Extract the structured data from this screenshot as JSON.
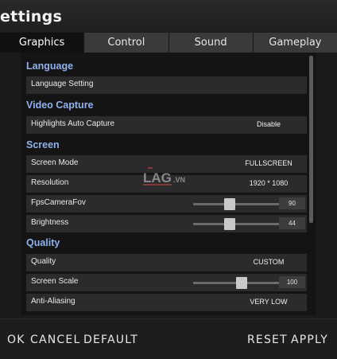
{
  "window": {
    "title": "ettings"
  },
  "tabs": [
    {
      "label": "Graphics",
      "active": true
    },
    {
      "label": "Control"
    },
    {
      "label": "Sound"
    },
    {
      "label": "Gameplay"
    }
  ],
  "sections": {
    "language": "Language",
    "video_capture": "Video Capture",
    "screen": "Screen",
    "quality": "Quality"
  },
  "rows": {
    "language_setting": {
      "label": "Language Setting",
      "value": ""
    },
    "highlights_auto_capture": {
      "label": "Highlights Auto Capture",
      "value": "Disable"
    },
    "screen_mode": {
      "label": "Screen Mode",
      "value": "FULLSCREEN"
    },
    "resolution": {
      "label": "Resolution",
      "value": "1920 * 1080"
    },
    "fps_camera_fov": {
      "label": "FpsCameraFov",
      "value": "90",
      "fraction": 0.34
    },
    "brightness": {
      "label": "Brightness",
      "value": "44",
      "fraction": 0.34
    },
    "quality": {
      "label": "Quality",
      "value": "CUSTOM"
    },
    "screen_scale": {
      "label": "Screen Scale",
      "value": "100",
      "fraction": 0.45
    },
    "anti_aliasing": {
      "label": "Anti-Aliasing",
      "value": "VERY LOW"
    }
  },
  "buttons": {
    "ok": "OK",
    "cancel": "CANCEL",
    "default": "DEFAULT",
    "reset": "RESET",
    "apply": "APPLY"
  },
  "watermark": {
    "text_a": "LAG",
    "text_b": ".VN"
  },
  "colors": {
    "section_heading": "#8fb2ef",
    "active_tab": "#111111",
    "inactive_tab": "#3a3a3c"
  }
}
